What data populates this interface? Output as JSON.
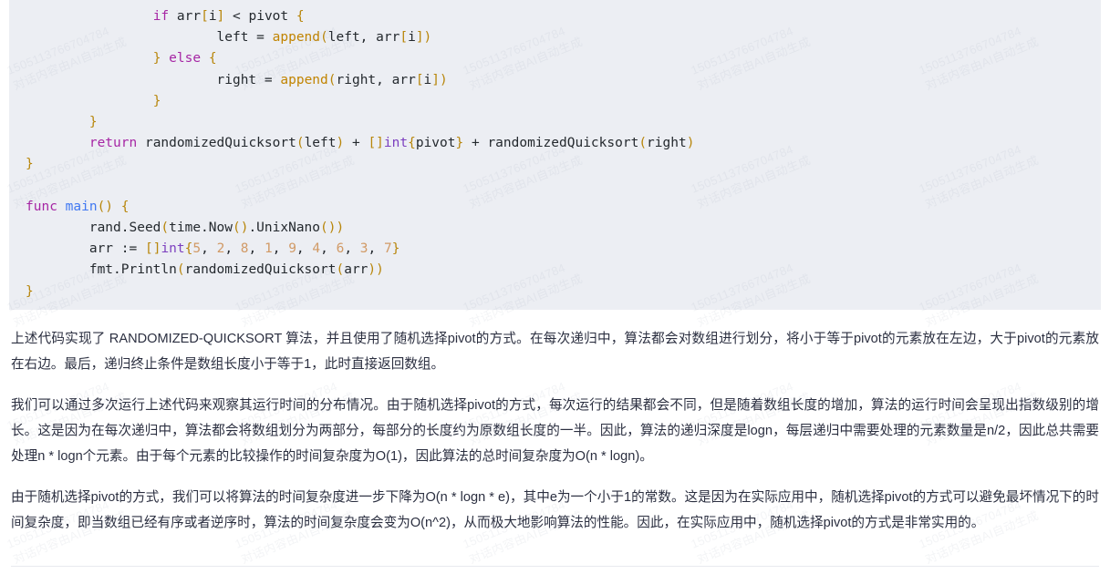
{
  "watermark": {
    "line1": "15051137667",
    "line2": "04784",
    "line3": "对话内容由AI自动生成",
    "combined_top": "1505113766704784",
    "combined_bottom": "对话内容由AI自动生成",
    "color": "#788096"
  },
  "code_block": {
    "language": "go",
    "background": "#eceef3",
    "lines": [
      "                if arr[i] < pivot {",
      "                        left = append(left, arr[i])",
      "                } else {",
      "                        right = append(right, arr[i])",
      "                }",
      "        }",
      "        return randomizedQuicksort(left) + []int{pivot} + randomizedQuicksort(right)",
      "}",
      "",
      "func main() {",
      "        rand.Seed(time.Now().UnixNano())",
      "        arr := []int{5, 2, 8, 1, 9, 4, 6, 3, 7}",
      "        fmt.Println(randomizedQuicksort(arr))",
      "}"
    ],
    "array_literal": [
      5,
      2,
      8,
      1,
      9,
      4,
      6,
      3,
      7
    ],
    "syntax_colors": {
      "keyword": "#a626a4",
      "type": "#7c3fbf",
      "function": "#4078f2",
      "builtin": "#c18401",
      "number": "#d19a66",
      "punctuation": "#b8860b",
      "plain": "#24292e"
    }
  },
  "prose": {
    "paragraph1": "上述代码实现了 RANDOMIZED-QUICKSORT 算法，并且使用了随机选择pivot的方式。在每次递归中，算法都会对数组进行划分，将小于等于pivot的元素放在左边，大于pivot的元素放在右边。最后，递归终止条件是数组长度小于等于1，此时直接返回数组。",
    "paragraph2": "我们可以通过多次运行上述代码来观察其运行时间的分布情况。由于随机选择pivot的方式，每次运行的结果都会不同，但是随着数组长度的增加，算法的运行时间会呈现出指数级别的增长。这是因为在每次递归中，算法都会将数组划分为两部分，每部分的长度约为原数组长度的一半。因此，算法的递归深度是logn，每层递归中需要处理的元素数量是n/2，因此总共需要处理n * logn个元素。由于每个元素的比较操作的时间复杂度为O(1)，因此算法的总时间复杂度为O(n * logn)。",
    "paragraph3": "由于随机选择pivot的方式，我们可以将算法的时间复杂度进一步下降为O(n * logn * e)，其中e为一个小于1的常数。这是因为在实际应用中，随机选择pivot的方式可以避免最坏情况下的时间复杂度，即当数组已经有序或者逆序时，算法的时间复杂度会变为O(n^2)，从而极大地影响算法的性能。因此，在实际应用中，随机选择pivot的方式是非常实用的。"
  }
}
